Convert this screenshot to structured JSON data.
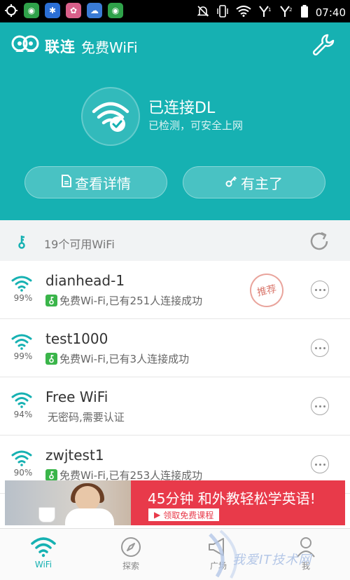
{
  "status_bar": {
    "time": "07:40"
  },
  "header": {
    "brand_name": "联连",
    "brand_sub": "免费WiFi",
    "connection_title": "已连接DL",
    "connection_subtitle": "已检测，可安全上网",
    "details_button": "查看详情",
    "owner_button": "有主了"
  },
  "wifi_count_text": "19个可用WiFi",
  "networks": [
    {
      "name": "dianhead-1",
      "signal": "99%",
      "desc": "免费Wi-Fi,已有251人连接成功",
      "badge": true,
      "recommended": "推荐"
    },
    {
      "name": "test1000",
      "signal": "99%",
      "desc": "免费Wi-Fi,已有3人连接成功",
      "badge": true
    },
    {
      "name": "Free WiFi",
      "signal": "94%",
      "desc": "无密码,需要认证",
      "badge": false
    },
    {
      "name": "zwjtest1",
      "signal": "90%",
      "desc": "免费Wi-Fi,已有253人连接成功",
      "badge": true
    }
  ],
  "ad": {
    "title": "45分钟 和外教轻松学英语!",
    "cta": "领取免费课程"
  },
  "tabs": [
    {
      "label": "WiFi",
      "icon": "wifi-icon",
      "active": true
    },
    {
      "label": "探索",
      "icon": "compass-icon",
      "active": false
    },
    {
      "label": "广场",
      "icon": "megaphone-icon",
      "active": false
    },
    {
      "label": "我",
      "icon": "user-icon",
      "active": false
    }
  ],
  "watermark": "我爱IT技术网",
  "colors": {
    "primary": "#16b1b2",
    "badge_green": "#3ab54a",
    "ad_red": "#e83a4a"
  }
}
